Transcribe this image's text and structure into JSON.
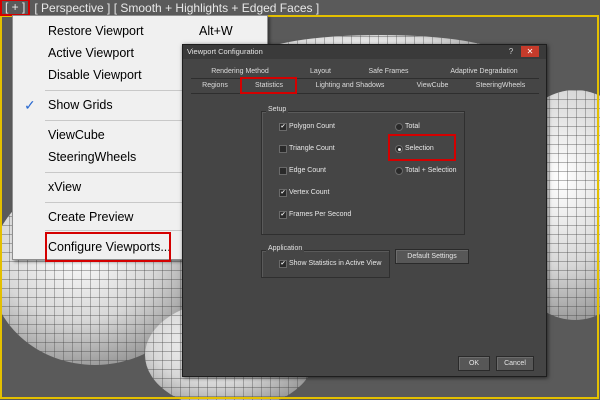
{
  "viewport": {
    "label": "[ Perspective ] [ Smooth + Highlights + Edged Faces ]",
    "plus": "[ + ]",
    "background": "#5a5a5a",
    "frame_color": "#e4c000"
  },
  "menu": {
    "items": [
      {
        "label": "Restore Viewport",
        "shortcut": "Alt+W"
      },
      {
        "label": "Active Viewport"
      },
      {
        "label": "Disable Viewport"
      },
      {
        "label": "Show Grids",
        "checked": "✓"
      },
      {
        "label": "ViewCube"
      },
      {
        "label": "SteeringWheels"
      },
      {
        "label": "xView"
      },
      {
        "label": "Create Preview"
      },
      {
        "label": "Configure Viewports..."
      }
    ]
  },
  "dialog": {
    "title": "Viewport Configuration",
    "help": "?",
    "close": "✕",
    "tabs_back": [
      "Rendering Method",
      "Layout",
      "Safe Frames",
      "Adaptive Degradation"
    ],
    "tabs_front": [
      "Regions",
      "Statistics",
      "Lighting and Shadows",
      "ViewCube",
      "SteeringWheels"
    ],
    "active_tab": "Statistics",
    "setup": {
      "label": "Setup",
      "checkboxes": [
        {
          "label": "Polygon Count",
          "checked": true
        },
        {
          "label": "Triangle Count",
          "checked": false
        },
        {
          "label": "Edge Count",
          "checked": false
        },
        {
          "label": "Vertex Count",
          "checked": true
        },
        {
          "label": "Frames Per Second",
          "checked": true
        }
      ],
      "radios": [
        {
          "label": "Total",
          "selected": false
        },
        {
          "label": "Selection",
          "selected": true
        },
        {
          "label": "Total + Selection",
          "selected": false
        }
      ]
    },
    "application": {
      "label": "Application",
      "checkbox": {
        "label": "Show Statistics in Active View",
        "checked": true
      }
    },
    "default_button": "Default Settings",
    "ok": "OK",
    "cancel": "Cancel"
  },
  "colors": {
    "highlight": "#d40000",
    "dialog_bg": "#454545",
    "menu_bg": "#f0f0f0",
    "check": "#2a6ad0"
  }
}
